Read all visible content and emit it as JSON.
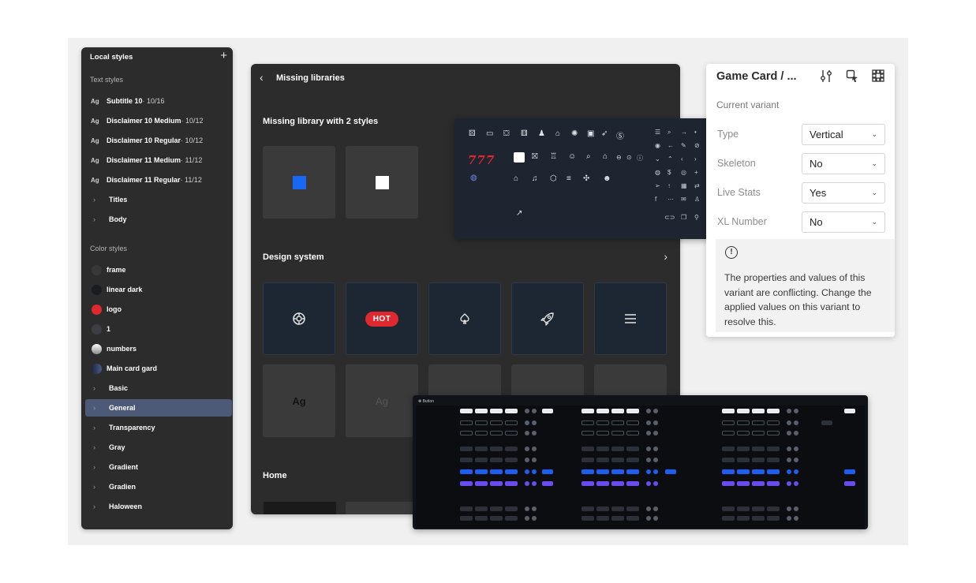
{
  "local_styles": {
    "title": "Local styles",
    "add_icon": "+",
    "text_styles_label": "Text styles",
    "text_styles": [
      {
        "prefix": "Ag",
        "name": "Subtitle 10",
        "meta": " · 10/16"
      },
      {
        "prefix": "Ag",
        "name": "Disclaimer 10 Medium",
        "meta": " · 10/12"
      },
      {
        "prefix": "Ag",
        "name": "Disclaimer 10 Regular",
        "meta": " · 10/12"
      },
      {
        "prefix": "Ag",
        "name": "Disclaimer 11 Medium",
        "meta": " · 11/12"
      },
      {
        "prefix": "Ag",
        "name": "Disclaimer 11 Regular",
        "meta": " · 11/12"
      }
    ],
    "text_groups": [
      "Titles",
      "Body"
    ],
    "color_styles_label": "Color styles",
    "color_styles": [
      {
        "name": "frame",
        "color": "#383838"
      },
      {
        "name": "linear dark",
        "color": "#1a1c22"
      },
      {
        "name": "logo",
        "color": "#e0282f"
      },
      {
        "name": "1",
        "color": "#3b3f44"
      },
      {
        "name": "numbers",
        "color": "#e8e8e8"
      },
      {
        "name": "Main card gard",
        "color": "#2d3a5a"
      }
    ],
    "color_groups": [
      "Basic",
      "General",
      "Transparency",
      "Gray",
      "Gradient",
      "Gradien",
      "Haloween"
    ],
    "selected_group": "General"
  },
  "missing_libraries": {
    "title": "Missing libraries",
    "section1": "Missing library with 2 styles",
    "section2": "Design system",
    "section3": "Home",
    "hot_badge": "HOT",
    "ag_label": "Ag",
    "swatch_colors": [
      "#1868f3",
      "#ffffff"
    ]
  },
  "icons_panel": {
    "jackpot_text": "777"
  },
  "props": {
    "title": "Game Card / ...",
    "current_variant": "Current variant",
    "fields": [
      {
        "label": "Type",
        "value": "Vertical"
      },
      {
        "label": "Skeleton",
        "value": "No"
      },
      {
        "label": "Live Stats",
        "value": "Yes"
      },
      {
        "label": "XL Number",
        "value": "No"
      }
    ],
    "warning": "The properties and values of this variant are conflicting. Change the applied values on this variant to resolve this."
  },
  "buttons_sheet": {
    "title": "Button"
  }
}
